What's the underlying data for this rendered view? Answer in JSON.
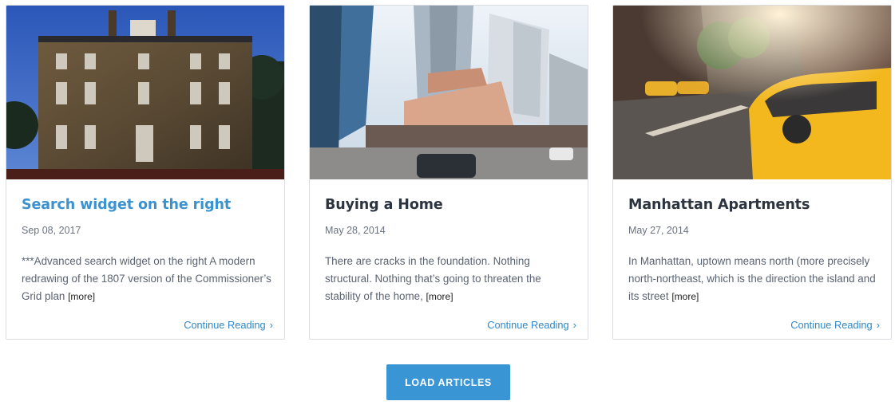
{
  "articles": [
    {
      "title": "Search widget on the right",
      "date": "Sep 08, 2017",
      "excerpt": "***Advanced search widget on the right A modern redrawing of the 1807 version of the Commissioner’s Grid plan",
      "more": "[more]",
      "continue": "Continue Reading",
      "image_alt": "stone-mansion-photo"
    },
    {
      "title": "Buying a Home",
      "date": "May 28, 2014",
      "excerpt": "There are cracks in the foundation. Nothing structural. Nothing that’s going to threaten the stability of the home,",
      "more": "[more]",
      "continue": "Continue Reading",
      "image_alt": "city-street-photo"
    },
    {
      "title": "Manhattan Apartments",
      "date": "May 27, 2014",
      "excerpt": "In Manhattan, uptown means north (more precisely north-northeast, which is the direction the island and its street",
      "more": "[more]",
      "continue": "Continue Reading",
      "image_alt": "yellow-taxi-photo"
    }
  ],
  "load_button": "LOAD ARTICLES",
  "colors": {
    "accent": "#3a95d5",
    "link": "#2f88c9",
    "title_active": "#3a92d0",
    "title": "#2c3440"
  }
}
